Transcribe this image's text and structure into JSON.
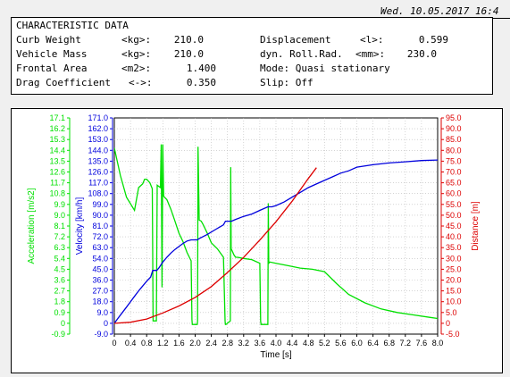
{
  "header": {
    "datetime": "Wed. 10.05.2017 16:4"
  },
  "panel": {
    "title": "CHARACTERISTIC DATA",
    "left": [
      {
        "label": "Curb Weight",
        "unit": "<kg>:",
        "value": "210.0"
      },
      {
        "label": "Vehicle Mass",
        "unit": "<kg>:",
        "value": "210.0"
      },
      {
        "label": "Frontal Area",
        "unit": "<m2>:",
        "value": "1.400"
      },
      {
        "label": "Drag Coefficient",
        "unit": "<->:",
        "value": "0.350"
      }
    ],
    "right": [
      {
        "label": "Displacement",
        "unit": "<l>:",
        "value": "0.599"
      },
      {
        "label": "dyn. Roll.Rad.",
        "unit": "<mm>:",
        "value": "230.0"
      },
      {
        "label": "Mode: Quasi stationary",
        "unit": "",
        "value": ""
      },
      {
        "label": "Slip: Off",
        "unit": "",
        "value": ""
      }
    ]
  },
  "chart_data": {
    "type": "line",
    "xlabel": "Time [s]",
    "xlim": [
      0,
      8.0
    ],
    "x_ticks": [
      "0",
      "0.4",
      "0.8",
      "1.2",
      "1.6",
      "2.0",
      "2.4",
      "2.8",
      "3.2",
      "3.6",
      "4.0",
      "4.4",
      "4.8",
      "5.2",
      "5.6",
      "6.0",
      "6.4",
      "6.8",
      "7.2",
      "7.6",
      "8.0"
    ],
    "axes": [
      {
        "id": "acc",
        "label": "Acceleration [m/s2]",
        "color": "#00e000",
        "lim": [
          -0.9,
          17.1
        ],
        "ticks": [
          "17.1",
          "16.2",
          "15.3",
          "14.4",
          "13.5",
          "12.6",
          "11.7",
          "10.8",
          "9.9",
          "9.0",
          "8.1",
          "7.2",
          "6.3",
          "5.4",
          "4.5",
          "3.6",
          "2.7",
          "1.8",
          "0.9",
          "0",
          "-0.9"
        ]
      },
      {
        "id": "vel",
        "label": "Velocity [km/h]",
        "color": "#0000dd",
        "lim": [
          -9.0,
          171.0
        ],
        "ticks": [
          "171.0",
          "162.0",
          "153.0",
          "144.0",
          "135.0",
          "126.0",
          "117.0",
          "108.0",
          "99.0",
          "90.0",
          "81.0",
          "72.0",
          "63.0",
          "54.0",
          "45.0",
          "36.0",
          "27.0",
          "18.0",
          "9.0",
          "0",
          "-9.0"
        ]
      },
      {
        "id": "dist",
        "label": "Distance [m]",
        "color": "#dd0000",
        "lim": [
          -5.0,
          95.0
        ],
        "ticks": [
          "95.0",
          "90.0",
          "85.0",
          "80.0",
          "75.0",
          "70.0",
          "65.0",
          "60.0",
          "55.0",
          "50.0",
          "45.0",
          "40.0",
          "35.0",
          "30.0",
          "25.0",
          "20.0",
          "15.0",
          "10.0",
          "5.0",
          "0",
          "-5.0"
        ]
      }
    ],
    "series": [
      {
        "axis": "acc",
        "color": "#00e000",
        "x": [
          0,
          0.15,
          0.3,
          0.5,
          0.6,
          0.7,
          0.75,
          0.8,
          0.88,
          0.94,
          0.95,
          0.96,
          1.04,
          1.05,
          1.06,
          1.14,
          1.16,
          1.18,
          1.2,
          1.22,
          1.24,
          1.3,
          1.4,
          1.5,
          1.6,
          1.7,
          1.8,
          1.9,
          1.92,
          1.93,
          1.94,
          2.05,
          2.06,
          2.07,
          2.1,
          2.15,
          2.2,
          2.3,
          2.4,
          2.55,
          2.7,
          2.74,
          2.75,
          2.76,
          2.87,
          2.88,
          2.89,
          2.92,
          2.96,
          3.0,
          3.05,
          3.2,
          3.4,
          3.6,
          3.62,
          3.63,
          3.64,
          3.8,
          3.81,
          3.82,
          3.85,
          4.0,
          4.3,
          4.6,
          4.9,
          5.2,
          5.5,
          5.8,
          6.2,
          6.6,
          7.0,
          7.4,
          7.8,
          8.0
        ],
        "y": [
          14.6,
          12.3,
          10.5,
          9.4,
          11.3,
          11.6,
          12.0,
          12.0,
          11.7,
          11.2,
          5.5,
          0.2,
          0.2,
          5.5,
          11.5,
          11.3,
          14.9,
          3.0,
          14.9,
          10.6,
          10.5,
          10.3,
          9.5,
          8.5,
          7.5,
          6.8,
          5.9,
          5.2,
          0.3,
          -0.1,
          -0.1,
          -0.1,
          0.2,
          14.7,
          8.6,
          8.5,
          8.2,
          7.5,
          6.7,
          6.2,
          5.5,
          0.2,
          -0.1,
          -0.1,
          0.2,
          13.0,
          6.2,
          6.0,
          5.7,
          5.5,
          5.5,
          5.4,
          5.3,
          5.0,
          0.2,
          -0.1,
          -0.1,
          -0.1,
          10.0,
          5.0,
          5.1,
          5.0,
          4.8,
          4.6,
          4.5,
          4.3,
          3.3,
          2.4,
          1.7,
          1.2,
          0.9,
          0.7,
          0.5,
          0.4
        ]
      },
      {
        "axis": "vel",
        "color": "#0000dd",
        "x": [
          0,
          0.1,
          0.2,
          0.3,
          0.4,
          0.5,
          0.6,
          0.7,
          0.8,
          0.9,
          0.95,
          1.05,
          1.1,
          1.2,
          1.3,
          1.4,
          1.5,
          1.6,
          1.7,
          1.8,
          1.9,
          1.95,
          2.05,
          2.1,
          2.3,
          2.5,
          2.7,
          2.75,
          2.9,
          3.0,
          3.2,
          3.4,
          3.6,
          3.8,
          3.9,
          4.0,
          4.2,
          4.4,
          4.6,
          4.8,
          5.0,
          5.2,
          5.4,
          5.6,
          5.8,
          6.0,
          6.4,
          6.8,
          7.2,
          7.6,
          8.0
        ],
        "y": [
          0,
          4.5,
          9.0,
          13.5,
          18.0,
          22.5,
          27.0,
          31.0,
          35.0,
          38.5,
          44.0,
          44.0,
          46.0,
          51.0,
          55.0,
          58.5,
          61.5,
          64.0,
          66.5,
          68.5,
          69.5,
          69.5,
          69.5,
          70.5,
          74.0,
          78.0,
          82.0,
          85.0,
          85.0,
          86.5,
          89.0,
          91.0,
          94.0,
          97.0,
          97.0,
          98.0,
          101.0,
          105.0,
          109.0,
          113.0,
          116.0,
          119.0,
          122.0,
          125.0,
          127.0,
          130.0,
          132.0,
          133.5,
          134.5,
          135.5,
          136.0
        ]
      },
      {
        "axis": "dist",
        "color": "#dd0000",
        "x": [
          0,
          0.4,
          0.8,
          1.2,
          1.6,
          2.0,
          2.4,
          2.8,
          3.2,
          3.6,
          4.0,
          4.4,
          4.8,
          5.0
        ],
        "y": [
          0,
          0.5,
          2.0,
          4.8,
          8.0,
          12.0,
          17.0,
          23.5,
          30.5,
          38.5,
          47.0,
          56.5,
          67.0,
          72.0
        ]
      }
    ]
  }
}
